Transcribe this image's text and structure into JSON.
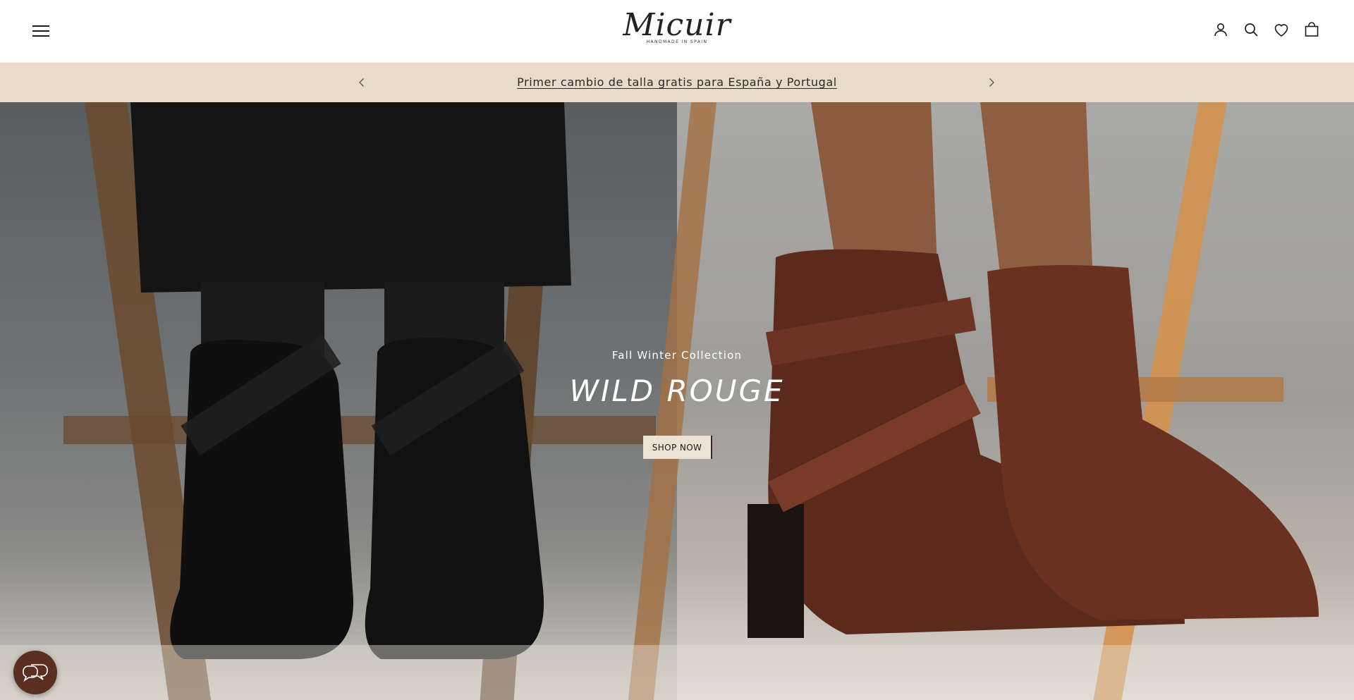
{
  "header": {
    "menu_icon": "hamburger-menu-icon",
    "logo": {
      "name": "Micuir",
      "tagline": "HANDMADE IN SPAIN"
    },
    "icons": [
      "account-icon",
      "search-icon",
      "wishlist-heart-icon",
      "cart-bag-icon"
    ]
  },
  "announcement": {
    "text": "Primer cambio de talla gratis para España y Portugal",
    "prev_icon": "chevron-left-icon",
    "next_icon": "chevron-right-icon",
    "background": "#e8dcc8"
  },
  "hero": {
    "subtitle": "Fall Winter Collection",
    "title": "WILD ROUGE",
    "cta": "SHOP NOW"
  },
  "chat": {
    "icon": "chat-bubbles-icon",
    "color": "#5a2f22"
  }
}
